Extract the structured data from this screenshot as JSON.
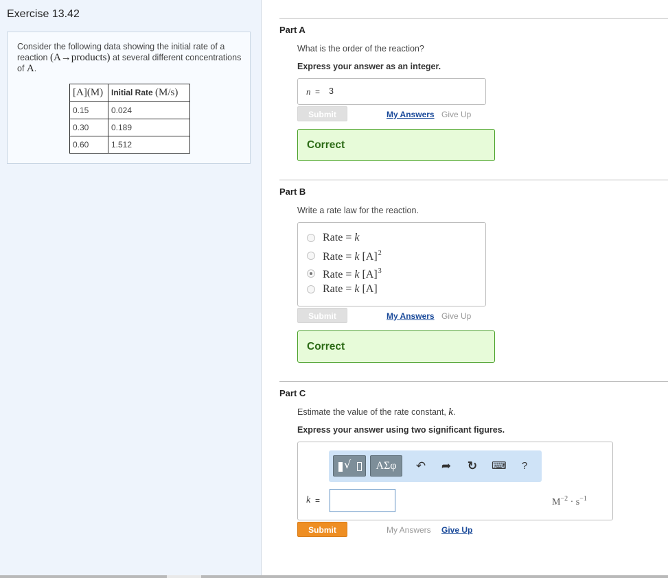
{
  "exercise": {
    "title": "Exercise 13.42"
  },
  "problem": {
    "intro_1": "Consider the following data showing the initial rate of a reaction",
    "reaction": "(A→products)",
    "intro_2": "at several different concentrations of",
    "species": "A",
    "intro_3": ".",
    "table": {
      "col1_header": "[A](M)",
      "col2_header_text": "Initial Rate",
      "col2_header_unit": "(M/s)",
      "rows": [
        {
          "conc": "0.15",
          "rate": "0.024"
        },
        {
          "conc": "0.30",
          "rate": "0.189"
        },
        {
          "conc": "0.60",
          "rate": "1.512"
        }
      ]
    }
  },
  "part_a": {
    "title": "Part A",
    "question": "What is the order of the reaction?",
    "instruction": "Express your answer as an integer.",
    "var": "n",
    "eq": "=",
    "value": "3",
    "submit": "Submit",
    "my_answers": "My Answers",
    "give_up": "Give Up",
    "feedback": "Correct"
  },
  "part_b": {
    "title": "Part B",
    "question": "Write a rate law for the reaction.",
    "options": [
      {
        "rate": "Rate",
        "eq": "=",
        "k": "k",
        "conc": "",
        "exp": "",
        "selected": false
      },
      {
        "rate": "Rate",
        "eq": "=",
        "k": "k",
        "conc": "[A]",
        "exp": "2",
        "selected": false
      },
      {
        "rate": "Rate",
        "eq": "=",
        "k": "k",
        "conc": "[A]",
        "exp": "3",
        "selected": true
      },
      {
        "rate": "Rate",
        "eq": "=",
        "k": "k",
        "conc": "[A]",
        "exp": "",
        "selected": false
      }
    ],
    "submit": "Submit",
    "my_answers": "My Answers",
    "give_up": "Give Up",
    "feedback": "Correct"
  },
  "part_c": {
    "title": "Part C",
    "question_1": "Estimate the value of the rate constant,",
    "question_var": "k",
    "question_end": ".",
    "instruction": "Express your answer using two significant figures.",
    "toolbar": {
      "greek_label": "ΑΣφ",
      "undo_icon": "↶",
      "redo_icon": "➦",
      "reset_icon": "↻",
      "keyboard_icon": "⌨",
      "help_label": "?"
    },
    "var": "k",
    "eq": "=",
    "input_value": "",
    "units_base_1": "M",
    "units_exp_1": "−2",
    "units_dot": "·",
    "units_base_2": "s",
    "units_exp_2": "−1",
    "submit": "Submit",
    "my_answers": "My Answers",
    "give_up": "Give Up"
  },
  "colors": {
    "correct_bg": "#e7fbd9",
    "correct_border": "#4aa12a",
    "submit_orange": "#ee8e23",
    "link_blue": "#1a4a9a",
    "left_panel_bg": "#eef4fc"
  }
}
